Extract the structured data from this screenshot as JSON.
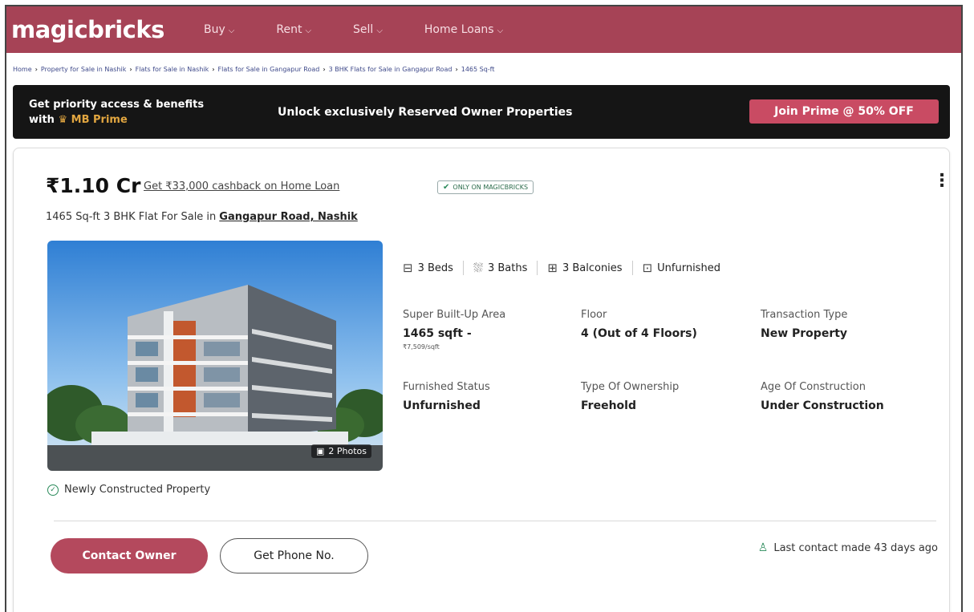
{
  "nav": {
    "logo": "magicbricks",
    "items": [
      {
        "label": "Buy"
      },
      {
        "label": "Rent"
      },
      {
        "label": "Sell"
      },
      {
        "label": "Home Loans"
      }
    ]
  },
  "breadcrumb": [
    "Home",
    "Property for Sale in Nashik",
    "Flats for Sale in Nashik",
    "Flats for Sale in Gangapur Road",
    "3 BHK Flats for Sale in Gangapur Road",
    "1465 Sq-ft"
  ],
  "prime": {
    "line1": "Get priority access & benefits",
    "line2_prefix": "with",
    "crown": "♛",
    "brand": "MB Prime",
    "message": "Unlock exclusively Reserved Owner Properties",
    "button": "Join Prime @ 50% OFF"
  },
  "listing": {
    "price": "₹1.10 Cr",
    "cashback": "Get ₹33,000 cashback on Home Loan",
    "badge": "ONLY ON MAGICBRICKS",
    "title": "1465 Sq-ft 3 BHK Flat For Sale in",
    "location": "Gangapur Road, Nashik",
    "photo_count": "2 Photos",
    "newly_constructed": "Newly Constructed Property",
    "amenities": [
      {
        "icon": "bed-icon",
        "label": "3 Beds"
      },
      {
        "icon": "bath-icon",
        "label": "3 Baths"
      },
      {
        "icon": "balcony-icon",
        "label": "3 Balconies"
      },
      {
        "icon": "furnishing-icon",
        "label": "Unfurnished"
      }
    ],
    "details": [
      {
        "label": "Super Built-Up Area",
        "value": "1465 sqft -",
        "sub": "₹7,509/sqft"
      },
      {
        "label": "Floor",
        "value": "4 (Out of 4 Floors)",
        "sub": ""
      },
      {
        "label": "Transaction Type",
        "value": "New Property",
        "sub": ""
      },
      {
        "label": "Furnished Status",
        "value": "Unfurnished",
        "sub": ""
      },
      {
        "label": "Type Of Ownership",
        "value": "Freehold",
        "sub": ""
      },
      {
        "label": "Age Of Construction",
        "value": "Under Construction",
        "sub": ""
      }
    ],
    "contact_button": "Contact Owner",
    "phone_button": "Get Phone No.",
    "last_contact": "Last contact made 43 days ago"
  },
  "colors": {
    "brand": "#a64356",
    "cta": "#c94b63",
    "prime_bg": "#151515",
    "prime_gold": "#e2a640"
  }
}
